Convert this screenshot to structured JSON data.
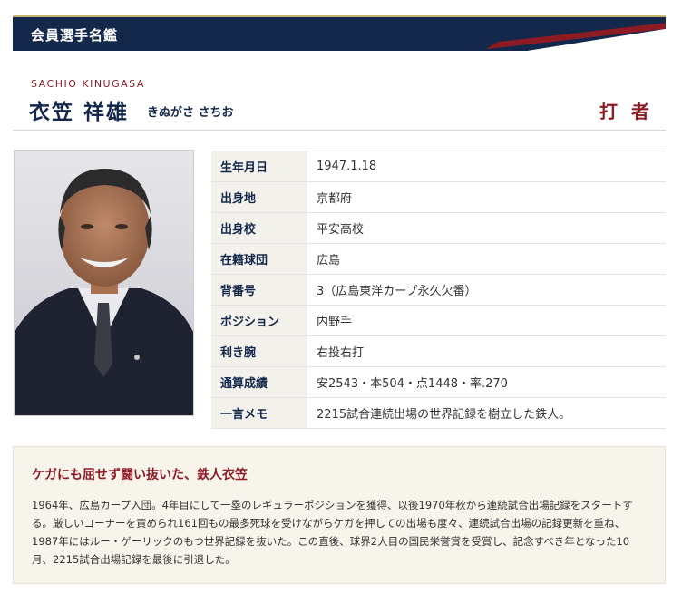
{
  "header": {
    "title": "会員選手名鑑"
  },
  "player": {
    "romaji": "SACHIO KINUGASA",
    "name": "衣笠 祥雄",
    "kana": "きぬがさ さちお",
    "category": "打 者"
  },
  "profile": {
    "rows": [
      {
        "label": "生年月日",
        "value": "1947.1.18"
      },
      {
        "label": "出身地",
        "value": "京都府"
      },
      {
        "label": "出身校",
        "value": "平安高校"
      },
      {
        "label": "在籍球団",
        "value": "広島"
      },
      {
        "label": "背番号",
        "value": "3（広島東洋カープ永久欠番）"
      },
      {
        "label": "ポジション",
        "value": "内野手"
      },
      {
        "label": "利き腕",
        "value": "右投右打"
      },
      {
        "label": "通算成績",
        "value": "安2543・本504・点1448・率.270"
      },
      {
        "label": "一言メモ",
        "value": "2215試合連続出場の世界記録を樹立した鉄人。"
      }
    ]
  },
  "bio": {
    "heading": "ケガにも屈せず闘い抜いた、鉄人衣笠",
    "text": "1964年、広島カープ入団。4年目にして一塁のレギュラーポジションを獲得、以後1970年秋から連続試合出場記録をスタートする。厳しいコーナーを責められ161回もの最多死球を受けながらケガを押しての出場も度々、連続試合出場の記録更新を重ね、1987年にはルー・ゲーリックのもつ世界記録を抜いた。この直後、球界2人目の国民栄誉賞を受賞し、記念すべき年となった10月、2215試合出場記録を最後に引退した。"
  },
  "colors": {
    "navy": "#14284b",
    "crimson": "#8e1b24",
    "gold": "#c9b27a"
  }
}
